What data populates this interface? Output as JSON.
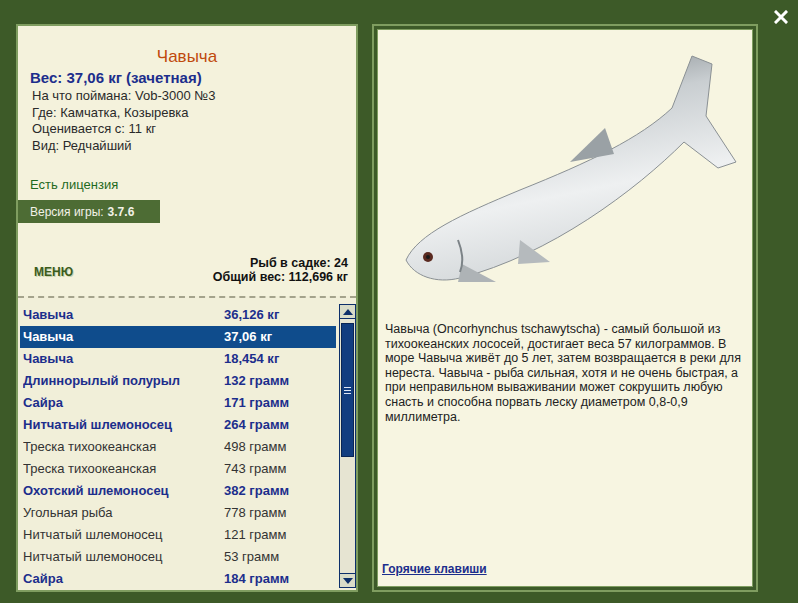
{
  "fish": {
    "name": "Чавыча",
    "weight": "Вес: 37,06 кг (зачетная)",
    "details": [
      "На что поймана: Vob-3000 №3",
      "Где: Камчатка, Козыревка",
      "Оценивается с: 11 кг",
      "Вид: Редчайший"
    ],
    "license": "Есть лицензия",
    "version_label": "Версия игры:",
    "version": "3.7.6"
  },
  "menu": "МЕНЮ",
  "keepnet": {
    "count": "Рыб в садке: 24",
    "total": "Общий вес: 112,696 кг"
  },
  "catch_list": [
    {
      "name": "Чавыча",
      "weight": "36,126 кг",
      "bold": true,
      "selected": false
    },
    {
      "name": "Чавыча",
      "weight": "37,06 кг",
      "bold": true,
      "selected": true
    },
    {
      "name": "Чавыча",
      "weight": "18,454 кг",
      "bold": true,
      "selected": false
    },
    {
      "name": "Длиннорылый полурыл",
      "weight": "132 грамм",
      "bold": true,
      "selected": false
    },
    {
      "name": "Сайра",
      "weight": "171 грамм",
      "bold": true,
      "selected": false
    },
    {
      "name": "Нитчатый шлемоносец",
      "weight": "264 грамм",
      "bold": true,
      "selected": false
    },
    {
      "name": "Треска тихоокеанская",
      "weight": "498 грамм",
      "bold": false,
      "selected": false
    },
    {
      "name": "Треска тихоокеанская",
      "weight": "743 грамм",
      "bold": false,
      "selected": false
    },
    {
      "name": "Охотский шлемоносец",
      "weight": "382 грамм",
      "bold": true,
      "selected": false
    },
    {
      "name": "Угольная рыба",
      "weight": "778 грамм",
      "bold": false,
      "selected": false
    },
    {
      "name": "Нитчатый шлемоносец",
      "weight": "121 грамм",
      "bold": false,
      "selected": false
    },
    {
      "name": "Нитчатый шлемоносец",
      "weight": "53 грамм",
      "bold": false,
      "selected": false
    },
    {
      "name": "Сайра",
      "weight": "184 грамм",
      "bold": true,
      "selected": false
    }
  ],
  "description": "Чавыча (Oncorhynchus tschawytscha) - самый большой из тихоокеанских лососей, достигает веса 57 килограммов. В море Чавыча живёт до 5 лет, затем возвращается в реки для нереста. Чавыча - рыба сильная, хотя и не очень быстрая, а при неправильном вываживании может сокрушить любую снасть и способна порвать леску диаметром 0,8-0,9 миллиметра.",
  "hotkeys": "Горячие клавиши"
}
